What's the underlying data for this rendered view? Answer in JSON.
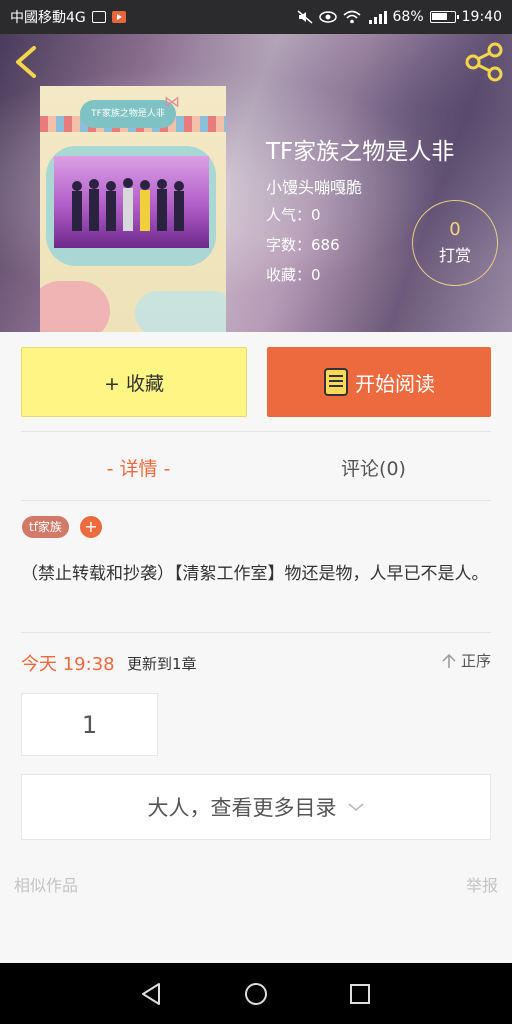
{
  "status_bar": {
    "carrier": "中國移動4G",
    "battery_pct": "68%",
    "time": "19:40"
  },
  "book": {
    "title": "TF家族之物是人非",
    "author": "小馒头嘣嘎脆",
    "popularity_label": "人气：",
    "popularity_value": "0",
    "word_count_label": "字数：",
    "word_count_value": "686",
    "favorites_label": "收藏：",
    "favorites_value": "0",
    "tip_count": "0",
    "tip_label": "打赏",
    "cover_text": "TF家族之物是人非"
  },
  "actions": {
    "favorite_label": "+ 收藏",
    "read_label": "开始阅读"
  },
  "tabs": {
    "detail": "- 详情 -",
    "comments": "评论(0)"
  },
  "tags": [
    "tf家族"
  ],
  "tag_add": "+",
  "description": "（禁止转载和抄袭）【清絮工作室】物还是物，人早已不是人。",
  "update": {
    "time": "今天 19:38",
    "chapter_text": "更新到1章",
    "sort_label": "正序"
  },
  "chapters": [
    "1"
  ],
  "more_toc": "大人，查看更多目录",
  "footer": {
    "similar": "相似作品",
    "report": "举报"
  },
  "colors": {
    "accent": "#ec6a3e",
    "favorite_bg": "#fdf584",
    "tip_ring": "#e7cf8a"
  }
}
